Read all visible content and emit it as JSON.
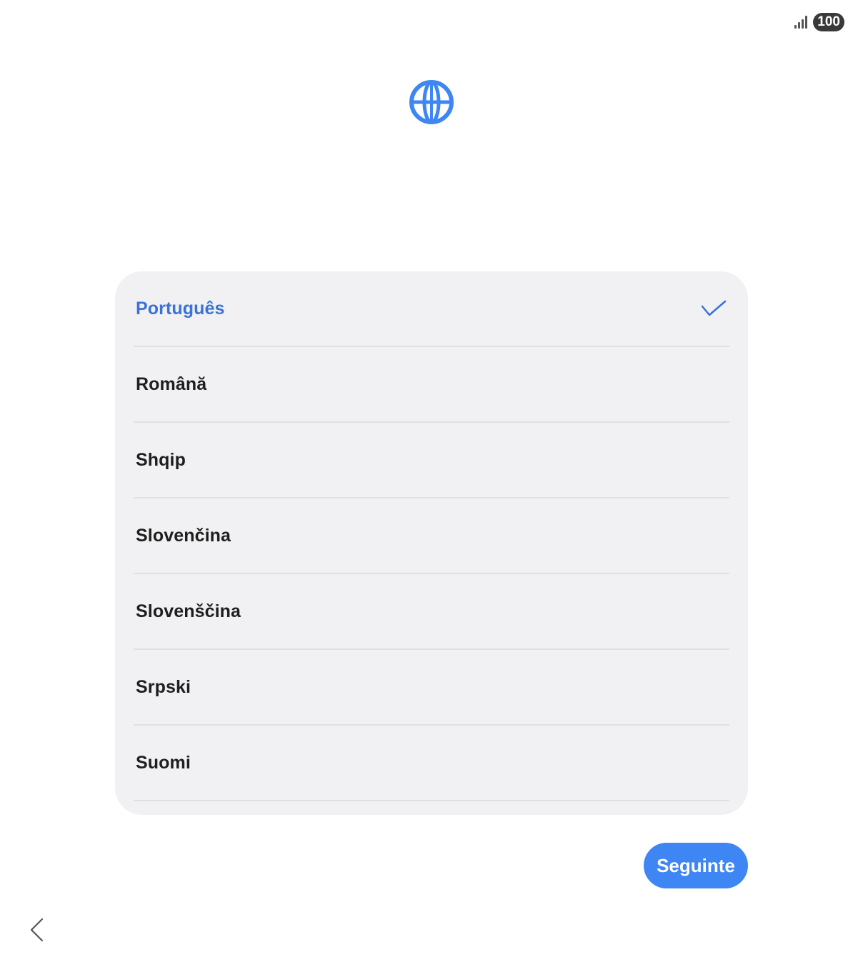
{
  "status_bar": {
    "battery": "100"
  },
  "languages": [
    {
      "label": "Português",
      "selected": true
    },
    {
      "label": "Română",
      "selected": false
    },
    {
      "label": "Shqip",
      "selected": false
    },
    {
      "label": "Slovenčina",
      "selected": false
    },
    {
      "label": "Slovenščina",
      "selected": false
    },
    {
      "label": "Srpski",
      "selected": false
    },
    {
      "label": "Suomi",
      "selected": false
    }
  ],
  "next_button": {
    "label": "Seguinte"
  },
  "icons": {
    "header": "globe-icon",
    "selected": "checkmark-icon",
    "back": "back-chevron-icon",
    "signal": "signal-strength-icon"
  },
  "colors": {
    "accent": "#3d86f3",
    "selected_text": "#3a72d8",
    "card_background": "#f1f1f3"
  }
}
